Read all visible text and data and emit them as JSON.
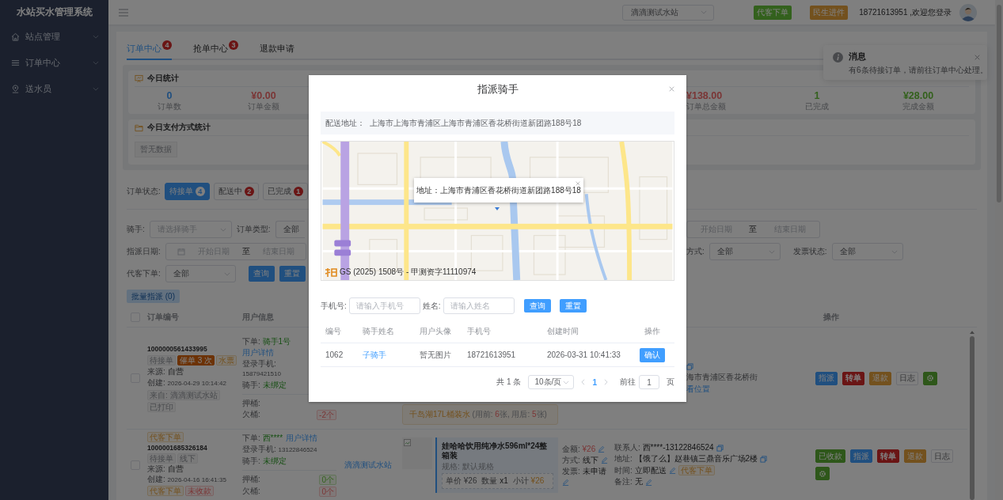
{
  "sidebar": {
    "title": "水站买水管理系统",
    "items": [
      {
        "label": "站点管理"
      },
      {
        "label": "订单中心"
      },
      {
        "label": "送水员"
      }
    ]
  },
  "header": {
    "station_select": "滴滴测试水站",
    "buttons": [
      {
        "label": "代客下单",
        "kind": "success"
      },
      {
        "label": "民生进件",
        "kind": "warning"
      }
    ],
    "user": "18721613951 ,欢迎您登录"
  },
  "notification": {
    "title": "消息",
    "message": "有6条待接订单，请前往订单中心处理。"
  },
  "tabs": [
    {
      "label": "订单中心",
      "badge": "4",
      "selected": true
    },
    {
      "label": "抢单中心",
      "badge": "3",
      "selected": false
    },
    {
      "label": "退款申请",
      "selected": false
    }
  ],
  "today_stats": {
    "title": "今日统计",
    "left": [
      {
        "value": "0",
        "label": "订单数",
        "kind": "primary"
      },
      {
        "value": "¥0.00",
        "label": "订单金额",
        "kind": "danger"
      }
    ],
    "right": [
      {
        "value": "¥138.00",
        "label": "订单总金额",
        "kind": "danger"
      },
      {
        "value": "1",
        "label": "已完成",
        "kind": "success"
      },
      {
        "value": "¥28.00",
        "label": "完成金额",
        "kind": "success"
      }
    ]
  },
  "payment_stats": {
    "title": "今日支付方式统计",
    "empty": "暂无数据"
  },
  "order_status": {
    "label": "订单状态:",
    "options": [
      {
        "label": "待接单",
        "count": "4",
        "selected": true
      },
      {
        "label": "配送中",
        "count": "2",
        "selected": false
      },
      {
        "label": "已完成",
        "count": "1",
        "selected": false
      }
    ]
  },
  "filters": {
    "rider": {
      "label": "骑手:",
      "placeholder": "请选择骑手"
    },
    "order_type": {
      "label": "订单类型:",
      "value": "全部"
    },
    "date_range": {
      "start": "开始日期",
      "separator": "至",
      "end": "结束日期"
    },
    "assign_date": {
      "label": "指派日期:",
      "start": "开始日期",
      "separator": "至",
      "end": "结束日期"
    },
    "pay_method": {
      "label": "方式:",
      "value": "全部"
    },
    "invoice_status": {
      "label": "发票状态:",
      "value": "全部"
    },
    "proxy_order": {
      "label": "代客下单:",
      "value": "全部"
    },
    "buttons": [
      "查询",
      "重置"
    ]
  },
  "batch_assign": {
    "label": "批量指派 (0)",
    "disabled": true
  },
  "table": {
    "all_checked": false,
    "columns": [
      "订单编号",
      "用户信息",
      "操作"
    ],
    "rows": [
      {
        "checked": false,
        "order_no": "1000000561433995",
        "status_tags": [
          {
            "text": "待接单",
            "kind": "plain"
          },
          {
            "text": "催单 3 次",
            "kind": "urge"
          },
          {
            "text": "水票",
            "kind": "warn"
          }
        ],
        "source": {
          "label": "来源:",
          "value": "自营"
        },
        "created": {
          "label": "创建:",
          "value": "2026-04-29 10:14:42"
        },
        "extra_tags": [
          {
            "text": "来自: 滴滴测试水站",
            "kind": "plain"
          },
          {
            "text": "已打印",
            "kind": "plain"
          }
        ],
        "user": {
          "orderer_label": "下单:",
          "orderer": "骑手1号",
          "detail_link": "用户详情",
          "phone_label": "登录手机:",
          "phone": "15879421510",
          "rider_label": "骑手:",
          "rider": "未绑定"
        },
        "buckets": [
          {
            "label": "押桶:"
          },
          {
            "label": "欠桶:",
            "tag": {
              "text": "-2个",
              "kind": "danger"
            }
          }
        ],
        "ticket_note": [
          {
            "text": "千岛湖17L桶装水",
            "kind": "product"
          },
          {
            "text": " (用前: ",
            "kind": "plain"
          },
          {
            "text": "6",
            "kind": "num"
          },
          {
            "text": "张, 用后: ",
            "kind": "plain"
          },
          {
            "text": "5",
            "kind": "num"
          },
          {
            "text": "张)",
            "kind": "plain"
          }
        ],
        "contact_partial": {
          "address": "海市青浦区香花桥街",
          "link": "看位置"
        },
        "actions": [
          {
            "label": "指派",
            "kind": "primary"
          },
          {
            "label": "转单",
            "kind": "danger"
          },
          {
            "label": "退款",
            "kind": "warning"
          },
          {
            "label": "日志",
            "kind": "plain"
          },
          {
            "kind": "icon"
          }
        ]
      },
      {
        "checked": false,
        "top_tag": "代客下单",
        "order_no": "1000001685326184",
        "status_tags": [
          {
            "text": "待接单",
            "kind": "plain"
          },
          {
            "text": "线下",
            "kind": "plain"
          }
        ],
        "source": {
          "label": "来源:",
          "value": "自营"
        },
        "created": {
          "label": "创建:",
          "value": "2026-04-16 16:41:35"
        },
        "extra_tags": [
          {
            "text": "代客下单",
            "kind": "warn"
          },
          {
            "text": "未收款",
            "kind": "danger"
          }
        ],
        "user": {
          "orderer_label": "下单:",
          "orderer": "西****",
          "detail_link": "用户详情",
          "phone_label": "登录手机:",
          "phone": "13122846524",
          "rider_label": "骑手:",
          "rider": "未绑定"
        },
        "buckets": [
          {
            "label": "押桶:",
            "tag": {
              "text": "0个",
              "kind": "success"
            }
          },
          {
            "label": "欠桶:",
            "tag": {
              "text": "0个",
              "kind": "danger"
            }
          }
        ],
        "station": "滴滴测试水站",
        "product": {
          "name": "娃哈哈饮用纯净水596ml*24整箱装",
          "spec": "规格: 默认规格",
          "price_label": "单价",
          "price": "¥26",
          "qty_label": "数量",
          "qty": "x1",
          "subtotal_label": "小计",
          "subtotal": "¥26"
        },
        "amount": [
          {
            "label": "金额:",
            "value": "¥26",
            "kind": "money"
          },
          {
            "label": "方式:",
            "value": "线下",
            "kind": "plain"
          },
          {
            "label": "发票:",
            "value": "未申请",
            "kind": "plain"
          }
        ],
        "contact": [
          {
            "label": "联系人:",
            "value": "西****-13122846524",
            "kind": "copy"
          },
          {
            "label": "地址:",
            "value": "【饿了么】赵巷镇三鼎音乐广场2楼",
            "kind": "copy"
          },
          {
            "label": "时间:",
            "value": "立即配送",
            "kind": "edit",
            "tag": "代客下单"
          },
          {
            "label": "备注:",
            "value": "无",
            "kind": "edit"
          }
        ],
        "actions": [
          {
            "label": "已收款",
            "kind": "success"
          },
          {
            "label": "指派",
            "kind": "primary"
          },
          {
            "label": "转单",
            "kind": "danger"
          },
          {
            "label": "退款",
            "kind": "warning"
          },
          {
            "label": "日志",
            "kind": "plain"
          },
          {
            "kind": "icon"
          }
        ]
      }
    ]
  },
  "dialog": {
    "title": "指派骑手",
    "address_label": "配送地址：",
    "address": "上海市上海市青浦区上海市青浦区香花桥街道新团路188号18",
    "map": {
      "popup": "地址：上海市青浦区香花桥街道新团路188号18",
      "copyright": "GS (2025) 1508号 - 甲测资字11110974"
    },
    "search": [
      {
        "label": "手机号:",
        "placeholder": "请输入手机号"
      },
      {
        "label": "姓名:",
        "placeholder": "请输入姓名"
      }
    ],
    "search_buttons": [
      "查询",
      "重置"
    ],
    "columns": [
      "编号",
      "骑手姓名",
      "用户头像",
      "手机号",
      "创建时间",
      "操作"
    ],
    "rows": [
      {
        "id": "1062",
        "name": "子骑手",
        "avatar": "暂无图片",
        "phone": "18721613951",
        "created": "2026-03-31 10:41:33",
        "action": "确认"
      }
    ],
    "pagination": {
      "total": "共 1 条",
      "page_size": "10条/页",
      "pages": [
        {
          "label": "1",
          "selected": true
        }
      ],
      "goto_label": "前往",
      "goto_value": "1",
      "goto_suffix": "页"
    }
  }
}
